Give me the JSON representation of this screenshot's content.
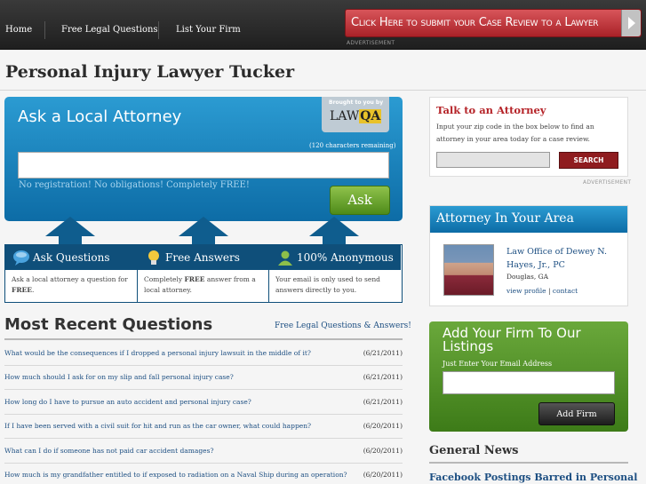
{
  "nav": {
    "items": [
      "Home",
      "Free Legal Questions",
      "List Your Firm"
    ],
    "cta_label": "Click Here to submit your Case Review to a Lawyer",
    "advertisement_label": "ADVERTISEMENT"
  },
  "page": {
    "title": "Personal Injury Lawyer Tucker"
  },
  "ask": {
    "title": "Ask a Local Attorney",
    "brought_by": "Brought to you by",
    "brand_law": "LAW",
    "brand_qa": "QA",
    "chars_remaining": "(120 characters remaining)",
    "input_value": "",
    "note": "No registration! No obligations! Completely FREE!",
    "button_label": "Ask"
  },
  "features": [
    {
      "title": "Ask Questions",
      "body_pre": "Ask a local attorney a question for ",
      "body_bold": "FREE",
      "body_post": ".",
      "icon": "chat-icon"
    },
    {
      "title": "Free Answers",
      "body_pre": "Completely ",
      "body_bold": "FREE",
      "body_post": " answer from a local attorney.",
      "icon": "lightbulb-icon"
    },
    {
      "title": "100% Anonymous",
      "body_pre": "Your email is only used to send answers directly to you.",
      "body_bold": "",
      "body_post": "",
      "icon": "person-icon"
    }
  ],
  "recent": {
    "title": "Most Recent Questions",
    "link": "Free Legal Questions & Answers!",
    "questions": [
      {
        "text": "What would be the consequences if I dropped a personal injury lawsuit in the middle of it?",
        "date": "(6/21/2011)"
      },
      {
        "text": "How much should I ask for on my slip and fall personal injury case?",
        "date": "(6/21/2011)"
      },
      {
        "text": "How long do I have to pursue an auto accident and personal injury case?",
        "date": "(6/21/2011)"
      },
      {
        "text": "If I have been served with a civil suit for hit and run as the car owner, what could happen?",
        "date": "(6/20/2011)"
      },
      {
        "text": "What can I do if someone has not paid car accident damages?",
        "date": "(6/20/2011)"
      },
      {
        "text": "How much is my grandfather entitled to if exposed to radiation on a Naval Ship during an operation?",
        "date": "(6/20/2011)"
      }
    ]
  },
  "talk": {
    "title": "Talk to an Attorney",
    "body": "Input your zip code in the box below to find an attorney in your area today for a case review.",
    "zip_value": "",
    "button_label": "SEARCH",
    "advertisement_label": "ADVERTISEMENT"
  },
  "area": {
    "title": "Attorney In Your Area",
    "firm_name": "Law Office of Dewey N. Hayes, Jr., PC",
    "city": "Douglas, GA",
    "view_profile": "view profile",
    "separator": " | ",
    "contact": "contact"
  },
  "listing": {
    "title": "Add Your Firm To Our Listings",
    "label": "Just Enter Your Email Address",
    "email_value": "",
    "button_label": "Add Firm"
  },
  "news": {
    "title": "General News",
    "headline": "Facebook Postings Barred in Personal"
  }
}
